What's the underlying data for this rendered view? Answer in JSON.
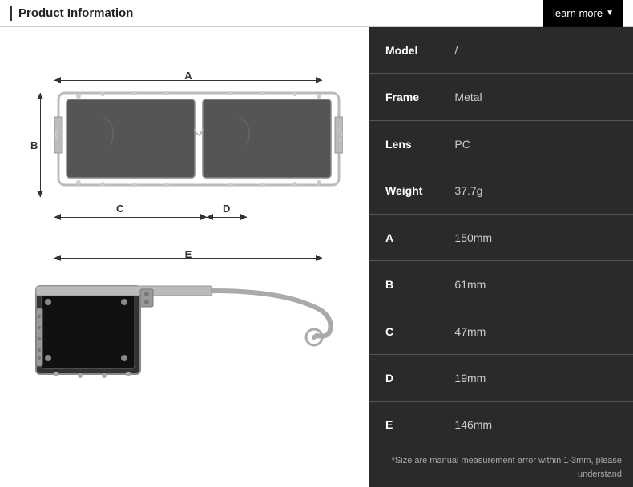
{
  "header": {
    "title": "Product Information",
    "learn_more": "learn more",
    "arrow": "▼"
  },
  "specs": [
    {
      "label": "Model",
      "value": "/"
    },
    {
      "label": "Frame",
      "value": "Metal"
    },
    {
      "label": "Lens",
      "value": "PC"
    },
    {
      "label": "Weight",
      "value": "37.7g"
    },
    {
      "label": "A",
      "value": "150mm"
    },
    {
      "label": "B",
      "value": "61mm"
    },
    {
      "label": "C",
      "value": "47mm"
    },
    {
      "label": "D",
      "value": "19mm"
    },
    {
      "label": "E",
      "value": "146mm"
    }
  ],
  "note": "*Size are manual measurement error within 1-3mm,\nplease understand",
  "dimensions": {
    "A_label": "A",
    "B_label": "B",
    "C_label": "C",
    "D_label": "D",
    "E_label": "E"
  }
}
